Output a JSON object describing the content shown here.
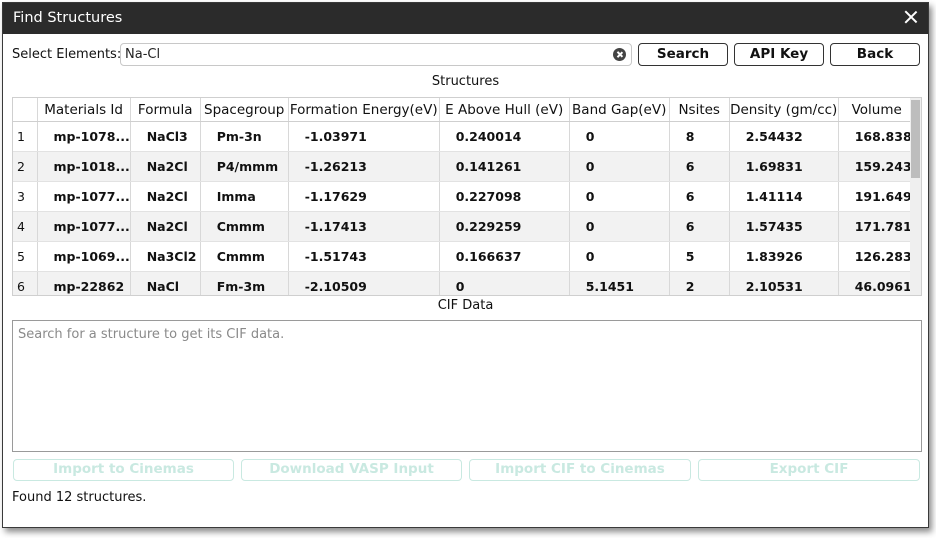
{
  "window": {
    "title": "Find Structures"
  },
  "search": {
    "label": "Select Elements:",
    "value": "Na-Cl"
  },
  "buttons": {
    "search": "Search",
    "api_key": "API Key",
    "back": "Back"
  },
  "structures": {
    "label": "Structures",
    "columns": [
      "Materials Id",
      "Formula",
      "Spacegroup",
      "Formation Energy(eV)",
      "E Above Hull (eV)",
      "Band Gap(eV)",
      "Nsites",
      "Density (gm/cc)",
      "Volume"
    ],
    "rows": [
      [
        "1",
        "mp-1078...",
        "NaCl3",
        "Pm-3n",
        "-1.03971",
        "0.240014",
        "0",
        "8",
        "2.54432",
        "168.838"
      ],
      [
        "2",
        "mp-1018...",
        "Na2Cl",
        "P4/mmm",
        "-1.26213",
        "0.141261",
        "0",
        "6",
        "1.69831",
        "159.243"
      ],
      [
        "3",
        "mp-1077...",
        "Na2Cl",
        "Imma",
        "-1.17629",
        "0.227098",
        "0",
        "6",
        "1.41114",
        "191.649"
      ],
      [
        "4",
        "mp-1077...",
        "Na2Cl",
        "Cmmm",
        "-1.17413",
        "0.229259",
        "0",
        "6",
        "1.57435",
        "171.781"
      ],
      [
        "5",
        "mp-1069...",
        "Na3Cl2",
        "Cmmm",
        "-1.51743",
        "0.166637",
        "0",
        "5",
        "1.83926",
        "126.283"
      ],
      [
        "6",
        "mp-22862",
        "NaCl",
        "Fm-3m",
        "-2.10509",
        "0",
        "5.1451",
        "2",
        "2.10531",
        "46.0961"
      ]
    ]
  },
  "cif": {
    "label": "CIF Data",
    "placeholder": "Search for a structure to get its CIF data."
  },
  "actions": {
    "import_cinemas": "Import to Cinemas",
    "download_vasp": "Download VASP Input",
    "import_cif": "Import CIF to Cinemas",
    "export_cif": "Export CIF"
  },
  "status": "Found 12 structures."
}
